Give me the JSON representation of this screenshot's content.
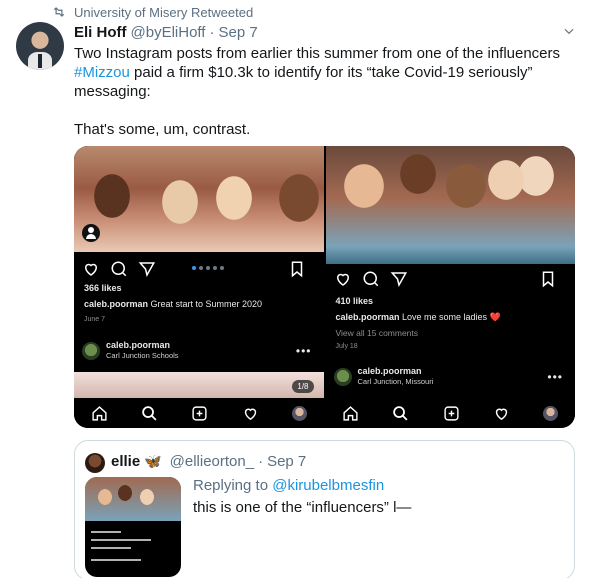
{
  "retweet": {
    "label": "University of Misery Retweeted"
  },
  "tweet": {
    "author_name": "Eli Hoff",
    "handle": "@byEliHoff",
    "separator": "·",
    "date": "Sep 7",
    "text_before": "Two Instagram posts from earlier this summer from one of the influencers ",
    "hashtag": "#Mizzou",
    "text_after": " paid a firm $10.3k to identify for its “take Covid-19 seriously” messaging:",
    "text_para2": "That's some, um, contrast."
  },
  "posts": [
    {
      "likes": "366 likes",
      "caption_user": "caleb.poorman",
      "caption_text": " Great start to Summer 2020",
      "date": "June 7",
      "author_user": "caleb.poorman",
      "author_subtitle": "Carl Junction Schools",
      "more": "•••",
      "counter": "1/8"
    },
    {
      "likes": "410 likes",
      "caption_user": "caleb.poorman",
      "caption_text": " Love me some ladies ❤️",
      "comments": "View all 15 comments",
      "date": "July 18",
      "author_user": "caleb.poorman",
      "author_subtitle": "Carl Junction, Missouri",
      "more": "•••"
    }
  ],
  "quoted": {
    "author_name": "ellie",
    "emoji": "🦋",
    "handle": "@ellieorton_",
    "separator": "·",
    "date": "Sep 7",
    "reply_prefix": "Replying to ",
    "reply_mention": "@kirubelbmesfin",
    "text": "this is one of the “influencers” l—"
  },
  "colors": {
    "accent": "#1b95e0",
    "muted": "#5b7083",
    "text": "#14171a",
    "border": "#cfd9de"
  },
  "icons": [
    "retweet-icon",
    "chevron-down-icon",
    "heart-icon",
    "comment-icon",
    "send-icon",
    "bookmark-icon",
    "home-icon",
    "search-icon",
    "add-icon",
    "activity-icon",
    "person-tag-icon"
  ]
}
